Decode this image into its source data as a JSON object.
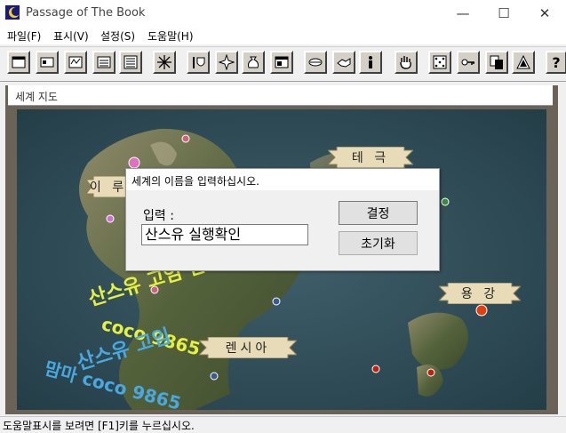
{
  "window": {
    "title": "Passage of The Book",
    "minimize_glyph": "—",
    "maximize_glyph": "☐",
    "close_glyph": "✕"
  },
  "menu": [
    "파일(F)",
    "표시(V)",
    "설정(S)",
    "도움말(H)"
  ],
  "toolbar_icons": [
    "window-icon",
    "card-icon",
    "map-icon",
    "list-icon",
    "document-icon",
    "sparkle-icon",
    "torch-shield-icon",
    "star-icon",
    "bag-icon",
    "panel-icon",
    "mouth-icon",
    "handshake-icon",
    "person-info-icon",
    "hand-icon",
    "dice-icon",
    "key-icon",
    "copy-icon",
    "triangle-icon",
    "help-icon"
  ],
  "help_glyph": "?",
  "map_window": {
    "title": "세계 지도"
  },
  "map": {
    "labels": {
      "tek": "테 극",
      "iru": "이 루",
      "yonggang": "용 강",
      "rensia": "렌시아"
    }
  },
  "dialog": {
    "title": "세계의 이름을 입력하십시오.",
    "input_label": "입력 :",
    "input_value": "산스유 실행확인",
    "ok_label": "결정",
    "reset_label": "초기화"
  },
  "watermark": {
    "line1": "산스유 고임 맘마",
    "line2": "coco 9865",
    "line3": "산스유 고임",
    "line4": "맘마 coco 9865"
  },
  "statusbar": {
    "text": "도움말표시를 보려면 [F1]키를 누르십시오."
  }
}
